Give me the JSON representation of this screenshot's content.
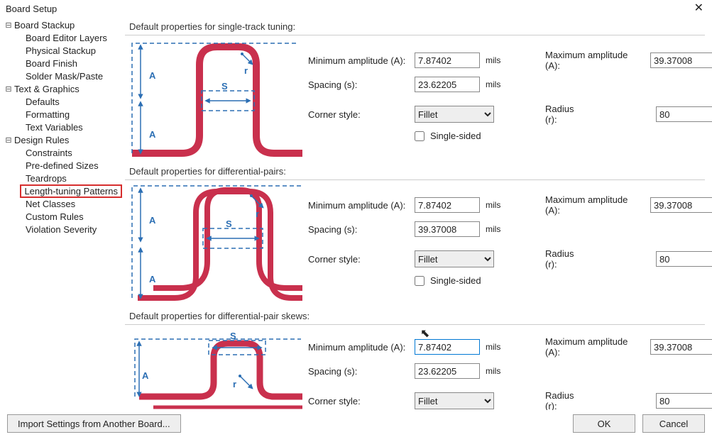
{
  "window": {
    "title": "Board Setup"
  },
  "tree": {
    "nodes": [
      {
        "label": "Board Stackup",
        "level": 0,
        "expander": "⊟"
      },
      {
        "label": "Board Editor Layers",
        "level": 1
      },
      {
        "label": "Physical Stackup",
        "level": 1
      },
      {
        "label": "Board Finish",
        "level": 1
      },
      {
        "label": "Solder Mask/Paste",
        "level": 1
      },
      {
        "label": "Text & Graphics",
        "level": 0,
        "expander": "⊟"
      },
      {
        "label": "Defaults",
        "level": 1
      },
      {
        "label": "Formatting",
        "level": 1
      },
      {
        "label": "Text Variables",
        "level": 1
      },
      {
        "label": "Design Rules",
        "level": 0,
        "expander": "⊟"
      },
      {
        "label": "Constraints",
        "level": 1
      },
      {
        "label": "Pre-defined Sizes",
        "level": 1
      },
      {
        "label": "Teardrops",
        "level": 1
      },
      {
        "label": "Length-tuning Patterns",
        "level": 1,
        "highlighted": true
      },
      {
        "label": "Net Classes",
        "level": 1
      },
      {
        "label": "Custom Rules",
        "level": 1
      },
      {
        "label": "Violation Severity",
        "level": 1
      }
    ]
  },
  "labels": {
    "minAmp": "Minimum amplitude (A):",
    "maxAmp": "Maximum amplitude (A):",
    "spacing": "Spacing (s):",
    "corner": "Corner style:",
    "singleSided": "Single-sided",
    "radius": "Radius (r):",
    "mils": "mils",
    "pct": "%"
  },
  "sections": {
    "single": {
      "header": "Default properties for single-track tuning:",
      "minAmp": "7.87402",
      "maxAmp": "39.37008",
      "spacing": "23.62205",
      "corner": "Fillet",
      "singleSided": false,
      "radius": "80"
    },
    "diff": {
      "header": "Default properties for differential-pairs:",
      "minAmp": "7.87402",
      "maxAmp": "39.37008",
      "spacing": "39.37008",
      "corner": "Fillet",
      "singleSided": false,
      "radius": "80"
    },
    "skew": {
      "header": "Default properties for differential-pair skews:",
      "minAmp": "7.87402",
      "maxAmp": "39.37008",
      "spacing": "23.62205",
      "corner": "Fillet",
      "radius": "80"
    }
  },
  "cornerOptions": [
    "Fillet"
  ],
  "buttons": {
    "import": "Import Settings from Another Board...",
    "ok": "OK",
    "cancel": "Cancel"
  },
  "diagram": {
    "A": "A",
    "S": "S",
    "r": "r"
  }
}
